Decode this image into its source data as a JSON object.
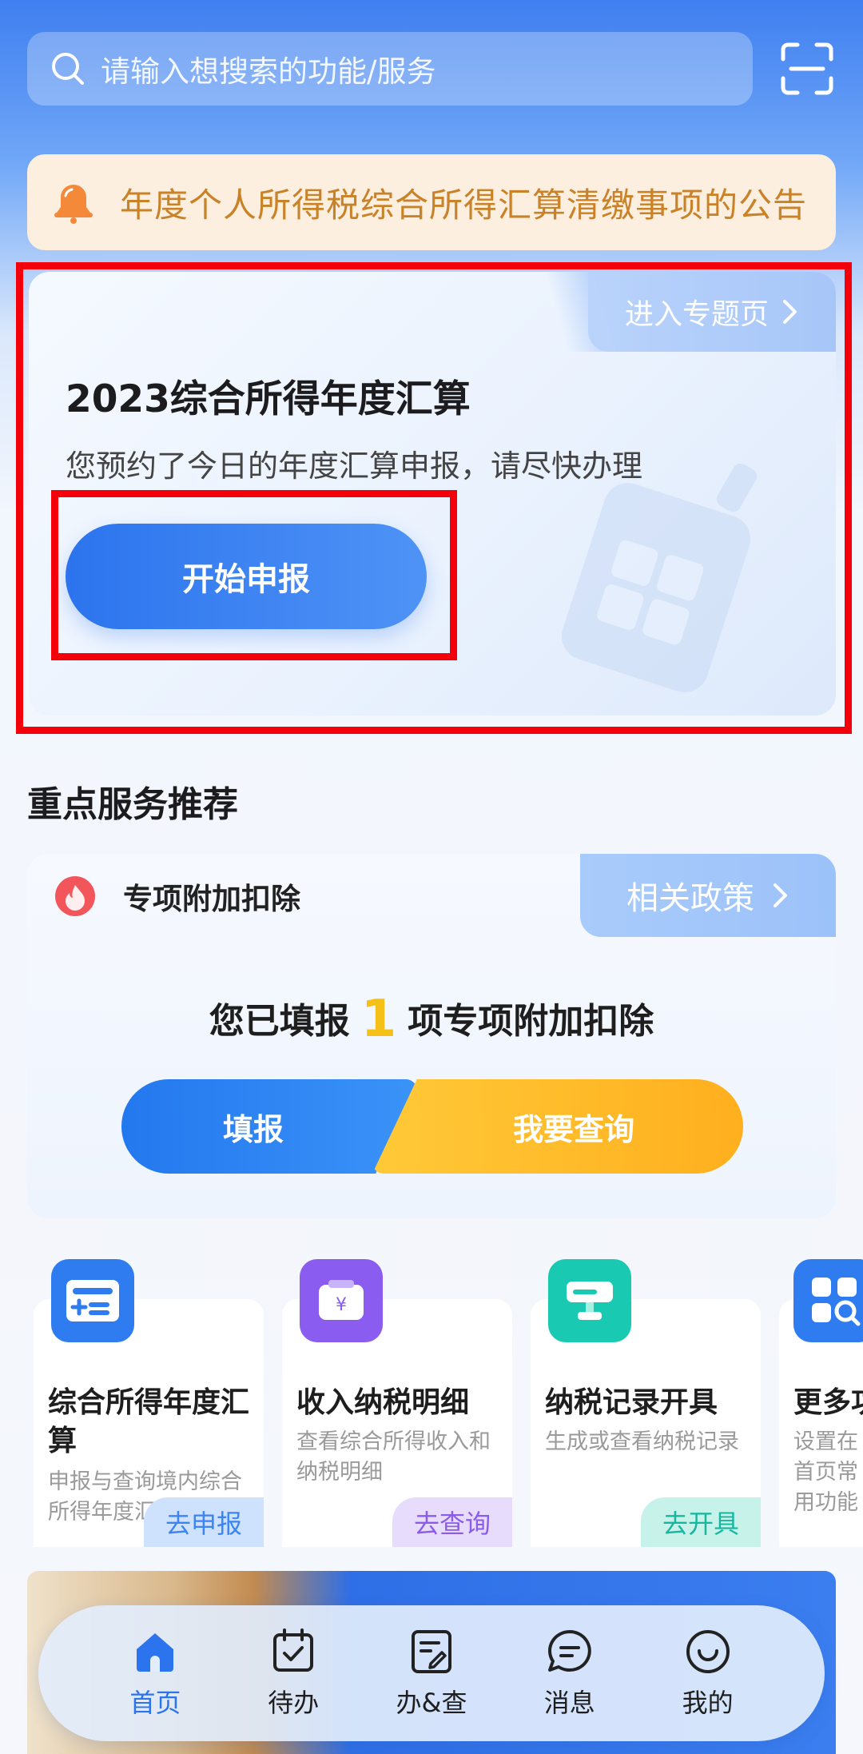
{
  "search": {
    "placeholder": "请输入想搜索的功能/服务"
  },
  "notice": {
    "text": "年度个人所得税综合所得汇算清缴事项的公告"
  },
  "annual_card": {
    "topic_link": "进入专题页",
    "title": "2023综合所得年度汇算",
    "subtitle": "您预约了今日的年度汇算申报，请尽快办理",
    "start_button": "开始申报"
  },
  "section": {
    "title": "重点服务推荐"
  },
  "deduction": {
    "title": "专项附加扣除",
    "policy_link": "相关政策",
    "filled_prefix": "您已填报",
    "filled_count": "1",
    "filled_suffix": "项专项附加扣除",
    "fill_button": "填报",
    "query_button": "我要查询"
  },
  "tiles": [
    {
      "name": "综合所得年度汇算",
      "desc": "申报与查询境内综合所得年度汇算",
      "action": "去申报",
      "icon": "id-card-icon",
      "color": "#2f7cf0",
      "action_bg": "#cfe2fd",
      "action_color": "#3c84f2"
    },
    {
      "name": "收入纳税明细",
      "desc": "查看综合所得收入和纳税明细",
      "action": "去查询",
      "icon": "wallet-icon",
      "color": "#8b5cf0",
      "action_bg": "#e8dcfc",
      "action_color": "#8a5ce8"
    },
    {
      "name": "纳税记录开具",
      "desc": "生成或查看纳税记录",
      "action": "去开具",
      "icon": "stamp-icon",
      "color": "#19c9b2",
      "action_bg": "#c7f2ea",
      "action_color": "#17b69f"
    },
    {
      "name": "更多功能",
      "desc": "设置在首页常用功能",
      "icon": "grid-search-icon",
      "color": "#2f7cf0"
    }
  ],
  "nav": [
    {
      "label": "首页",
      "icon": "home-icon",
      "active": true
    },
    {
      "label": "待办",
      "icon": "calendar-check-icon"
    },
    {
      "label": "办&查",
      "icon": "document-edit-icon"
    },
    {
      "label": "消息",
      "icon": "message-icon"
    },
    {
      "label": "我的",
      "icon": "smile-icon"
    }
  ]
}
